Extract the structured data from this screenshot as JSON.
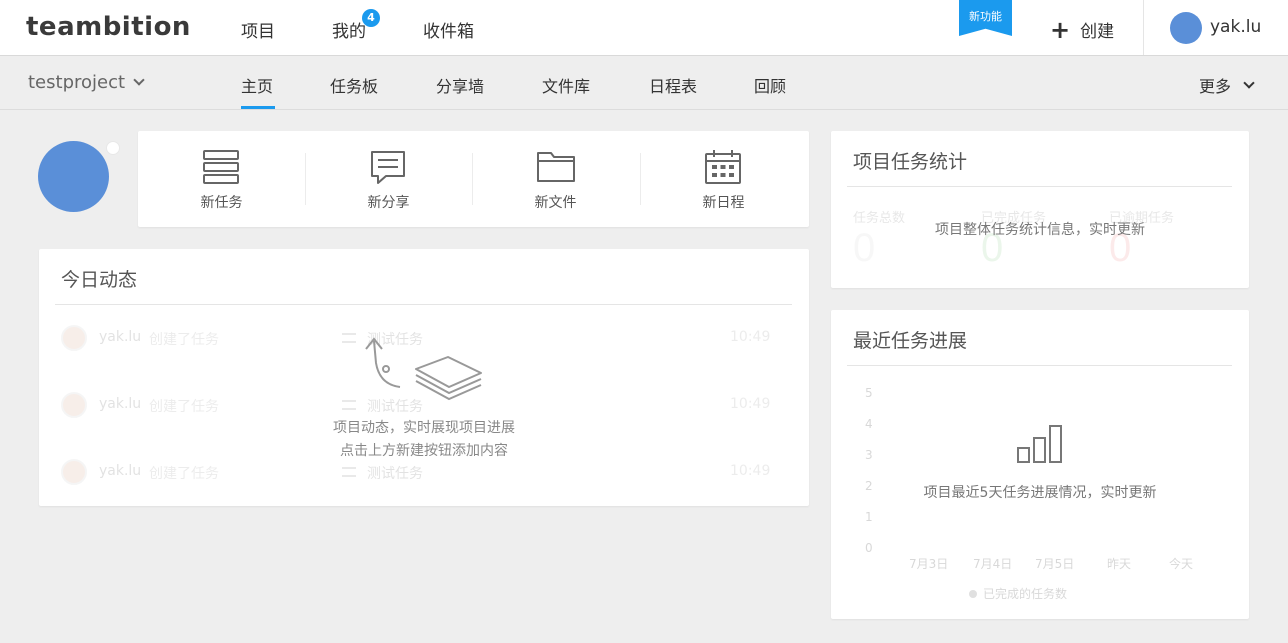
{
  "header": {
    "logo": "teambition",
    "nav": [
      {
        "label": "项目"
      },
      {
        "label": "我的",
        "badge": "4"
      },
      {
        "label": "收件箱"
      }
    ],
    "new_feature_ribbon": "新功能",
    "create_label": "创建",
    "username": "yak.lu"
  },
  "subnav": {
    "project_name": "testproject",
    "tabs": [
      "主页",
      "任务板",
      "分享墙",
      "文件库",
      "日程表",
      "回顾"
    ],
    "active_tab": "主页",
    "more_label": "更多"
  },
  "quick_actions": [
    {
      "label": "新任务",
      "icon": "task-stack-icon"
    },
    {
      "label": "新分享",
      "icon": "speech-bubble-icon"
    },
    {
      "label": "新文件",
      "icon": "folder-icon"
    },
    {
      "label": "新日程",
      "icon": "calendar-icon"
    }
  ],
  "activity": {
    "title": "今日动态",
    "rows": [
      {
        "user": "yak.lu",
        "action": "创建了任务",
        "task": "测试任务",
        "time": "10:49"
      },
      {
        "user": "yak.lu",
        "action": "创建了任务",
        "task": "测试任务",
        "time": "10:49"
      },
      {
        "user": "yak.lu",
        "action": "创建了任务",
        "task": "测试任务",
        "time": "10:49"
      }
    ],
    "empty_line1": "项目动态，实时展现项目进展",
    "empty_line2": "点击上方新建按钮添加内容"
  },
  "stats": {
    "title": "项目任务统计",
    "items": [
      {
        "label": "任务总数",
        "value": "0",
        "color": "#cccccc"
      },
      {
        "label": "已完成任务",
        "value": "0",
        "color": "#7ec87e"
      },
      {
        "label": "已逾期任务",
        "value": "0",
        "color": "#ee7777"
      }
    ],
    "empty_text": "项目整体任务统计信息，实时更新"
  },
  "progress": {
    "title": "最近任务进展",
    "y_ticks": [
      "5",
      "4",
      "3",
      "2",
      "1",
      "0"
    ],
    "x_ticks": [
      "7月3日",
      "7月4日",
      "7月5日",
      "昨天",
      "今天"
    ],
    "legend": "已完成的任务数",
    "empty_text": "项目最近5天任务进展情况，实时更新"
  },
  "colors": {
    "accent": "#1b9aee",
    "avatar": "#5a8fd8"
  }
}
